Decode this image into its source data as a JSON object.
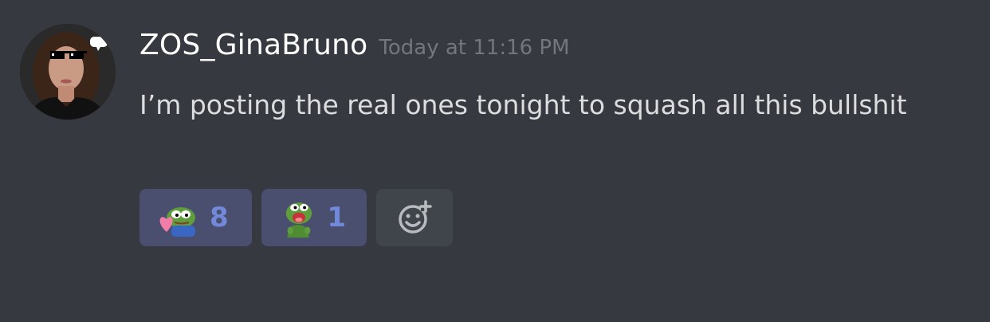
{
  "message": {
    "author": "ZOS_GinaBruno",
    "timestamp": "Today at 11:16 PM",
    "content": "I’m posting the real ones tonight to squash all this bullshit"
  },
  "reactions": [
    {
      "icon": "pepe-hug-heart-emoji",
      "count": "8"
    },
    {
      "icon": "pepe-screaming-emoji",
      "count": "1"
    }
  ],
  "add_reaction": {
    "icon": "add-reaction-icon"
  },
  "colors": {
    "background": "#36393f",
    "username": "#ffffff",
    "timestamp": "#72767d",
    "text": "#dcddde",
    "reaction_bg": "#4a4e6f",
    "reaction_count": "#7289da",
    "add_reaction_bg": "#40444b"
  }
}
